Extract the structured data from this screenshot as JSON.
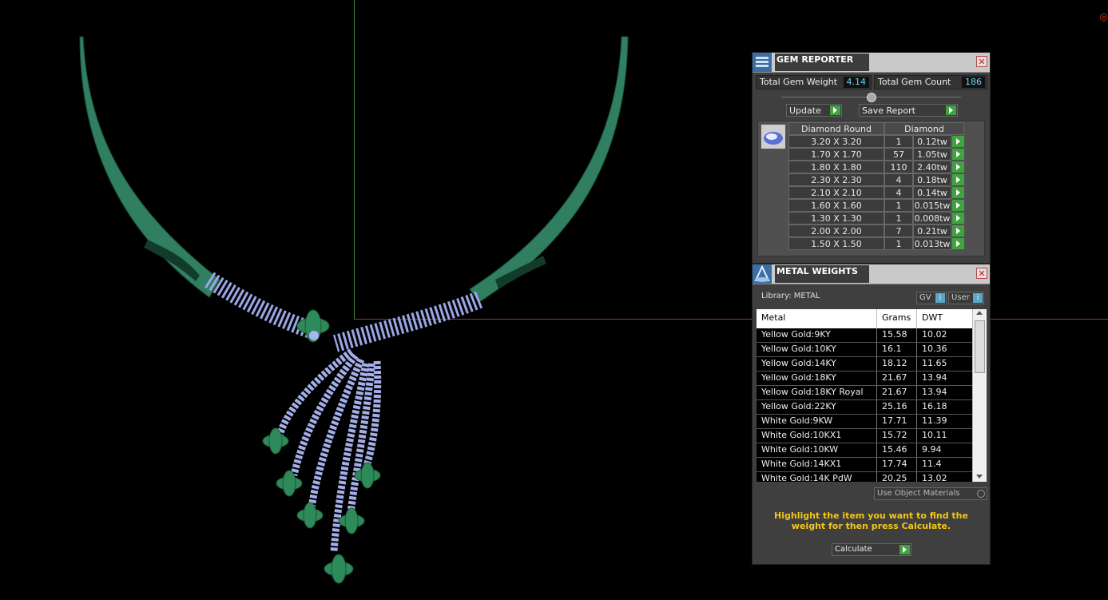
{
  "gem_reporter": {
    "title": "GEM REPORTER",
    "total_weight_label": "Total Gem Weight",
    "total_weight_value": "4.14",
    "total_count_label": "Total Gem Count",
    "total_count_value": "186",
    "update_label": "Update",
    "save_report_label": "Save Report",
    "table": {
      "shape_header": "Diamond Round",
      "material_header": "Diamond",
      "rows": [
        {
          "size": "3.20 X 3.20",
          "count": "1",
          "weight": "0.12tw"
        },
        {
          "size": "1.70 X 1.70",
          "count": "57",
          "weight": "1.05tw"
        },
        {
          "size": "1.80 X 1.80",
          "count": "110",
          "weight": "2.40tw"
        },
        {
          "size": "2.30 X 2.30",
          "count": "4",
          "weight": "0.18tw"
        },
        {
          "size": "2.10 X 2.10",
          "count": "4",
          "weight": "0.14tw"
        },
        {
          "size": "1.60 X 1.60",
          "count": "1",
          "weight": "0.015tw"
        },
        {
          "size": "1.30 X 1.30",
          "count": "1",
          "weight": "0.008tw"
        },
        {
          "size": "2.00 X 2.00",
          "count": "7",
          "weight": "0.21tw"
        },
        {
          "size": "1.50 X 1.50",
          "count": "1",
          "weight": "0.013tw"
        }
      ]
    }
  },
  "metal_weights": {
    "title": "METAL WEIGHTS",
    "library_label": "Library: METAL",
    "gv_label": "GV",
    "user_label": "User",
    "headers": {
      "metal": "Metal",
      "grams": "Grams",
      "dwt": "DWT"
    },
    "rows": [
      {
        "metal": "Yellow Gold:9KY",
        "grams": "15.58",
        "dwt": "10.02"
      },
      {
        "metal": "Yellow Gold:10KY",
        "grams": "16.1",
        "dwt": "10.36"
      },
      {
        "metal": "Yellow Gold:14KY",
        "grams": "18.12",
        "dwt": "11.65"
      },
      {
        "metal": "Yellow Gold:18KY",
        "grams": "21.67",
        "dwt": "13.94"
      },
      {
        "metal": "Yellow Gold:18KY Royal",
        "grams": "21.67",
        "dwt": "13.94"
      },
      {
        "metal": "Yellow Gold:22KY",
        "grams": "25.16",
        "dwt": "16.18"
      },
      {
        "metal": "White Gold:9KW",
        "grams": "17.71",
        "dwt": "11.39"
      },
      {
        "metal": "White Gold:10KX1",
        "grams": "15.72",
        "dwt": "10.11"
      },
      {
        "metal": "White Gold:10KW",
        "grams": "15.46",
        "dwt": "9.94"
      },
      {
        "metal": "White Gold:14KX1",
        "grams": "17.74",
        "dwt": "11.4"
      },
      {
        "metal": "White Gold:14K PdW",
        "grams": "20.25",
        "dwt": "13.02"
      }
    ],
    "use_object_materials_label": "Use Object Materials",
    "hint": "Highlight the item you want to find the weight for then press Calculate.",
    "calculate_label": "Calculate"
  },
  "colors": {
    "metal_green": "#2e7d5e",
    "gem_lavender": "#9aa6e6",
    "accent_green_button": "#3fa43f",
    "hint_yellow": "#f5c518",
    "value_cyan": "#6cd6f0"
  }
}
